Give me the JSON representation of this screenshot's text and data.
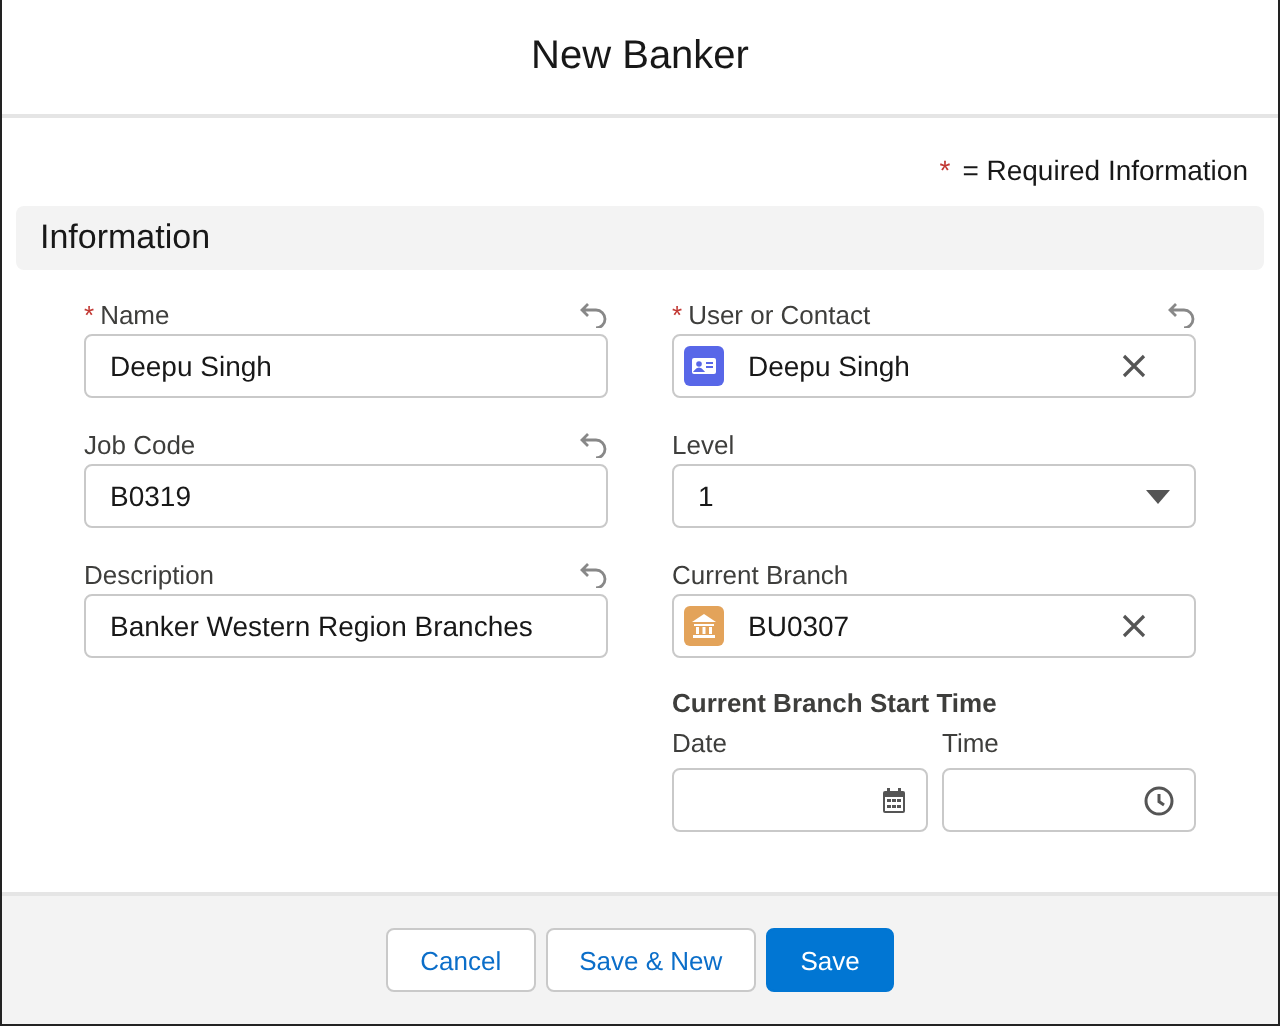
{
  "title": "New Banker",
  "required_note": {
    "mark": "*",
    "text": "= Required Information"
  },
  "section": "Information",
  "left_fields": [
    {
      "label": "Name",
      "required": true,
      "undo": true,
      "kind": "text",
      "value": "Deepu Singh"
    },
    {
      "label": "Job Code",
      "required": false,
      "undo": true,
      "kind": "text",
      "value": "B0319"
    },
    {
      "label": "Description",
      "required": false,
      "undo": true,
      "kind": "text",
      "value": "Banker Western Region Branches"
    }
  ],
  "right_fields": [
    {
      "label": "User or Contact",
      "required": true,
      "undo": true,
      "kind": "contact-lookup",
      "value": "Deepu Singh"
    },
    {
      "label": "Level",
      "required": false,
      "undo": false,
      "kind": "select",
      "value": "1"
    },
    {
      "label": "Current Branch",
      "required": false,
      "undo": false,
      "kind": "branch-lookup",
      "value": "BU0307"
    }
  ],
  "start_time": {
    "heading": "Current Branch Start Time",
    "date": {
      "label": "Date"
    },
    "time": {
      "label": "Time"
    }
  },
  "buttons": [
    {
      "label": "Cancel",
      "primary": false
    },
    {
      "label": "Save & New",
      "primary": false
    },
    {
      "label": "Save",
      "primary": true
    }
  ]
}
